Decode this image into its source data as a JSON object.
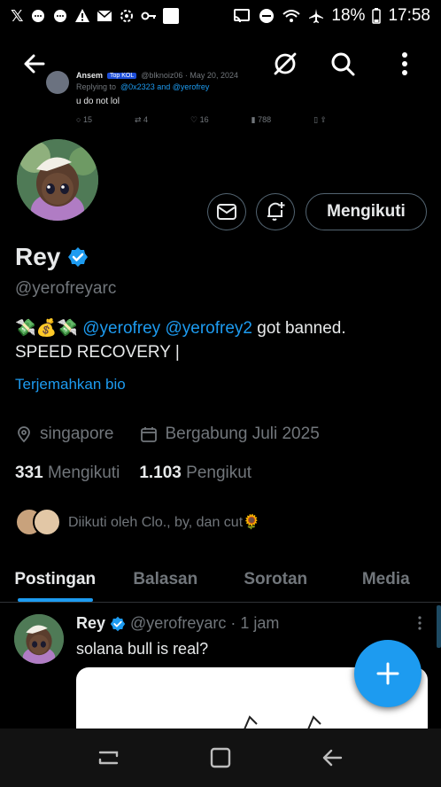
{
  "status_bar": {
    "battery": "18%",
    "time": "17:58"
  },
  "embedded_tweet": {
    "name": "Ansem",
    "badge": "Top KOL",
    "handle_date": "@blknoiz06 · May 20, 2024",
    "replying_prefix": "Replying to",
    "replying_users": "@0x2323 and @yerofrey",
    "text": "u do not lol",
    "replies": "15",
    "reposts": "4",
    "likes": "16",
    "views": "788"
  },
  "profile": {
    "name": "Rey",
    "handle": "@yerofreyarc",
    "bio_emoji": "💸💰💸",
    "bio_mention1": "@yerofrey",
    "bio_mention2": "@yerofrey2",
    "bio_rest": "got banned.",
    "bio_line2": "SPEED RECOVERY |",
    "translate": "Terjemahkan bio",
    "location": "singapore",
    "joined": "Bergabung Juli 2025",
    "following_count": "331",
    "following_label": "Mengikuti",
    "followers_count": "1.103",
    "followers_label": "Pengikut",
    "followed_by": "Diikuti oleh Clo., by, dan cut🌻",
    "follow_button": "Mengikuti"
  },
  "tabs": [
    "Postingan",
    "Balasan",
    "Sorotan",
    "Media"
  ],
  "post": {
    "name": "Rey",
    "handle_time": "@yerofreyarc · 1 jam",
    "text": "solana bull is real?"
  },
  "colors": {
    "accent": "#1d9bf0",
    "muted": "#71767b",
    "text": "#e7e9ea"
  }
}
